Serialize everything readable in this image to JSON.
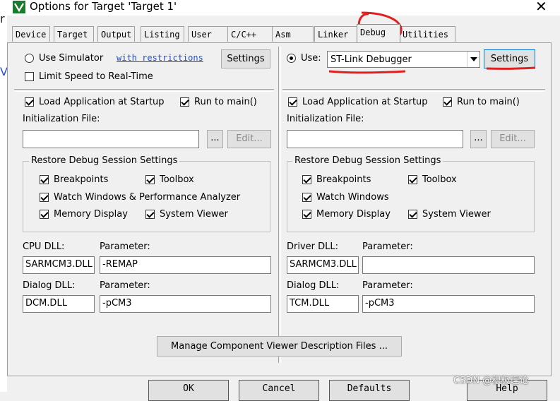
{
  "window": {
    "title": "Options for Target 'Target 1'",
    "close_glyph": "✕",
    "app_icon": "keil-uvision-icon",
    "edge_chars": [
      "r",
      "V"
    ]
  },
  "tabs": [
    {
      "label": "Device"
    },
    {
      "label": "Target"
    },
    {
      "label": "Output"
    },
    {
      "label": "Listing"
    },
    {
      "label": "User"
    },
    {
      "label": "C/C++"
    },
    {
      "label": "Asm"
    },
    {
      "label": "Linker"
    },
    {
      "label": "Debug",
      "active": true
    },
    {
      "label": "Utilities"
    }
  ],
  "left": {
    "use_simulator_label": "Use Simulator",
    "restrictions_link": "with restrictions",
    "settings_label": "Settings",
    "limit_speed_label": "Limit Speed to Real-Time",
    "load_app_label": "Load Application at Startup",
    "run_to_main_label": "Run to main()",
    "init_file_label": "Initialization File:",
    "init_file_value": "",
    "browse_label": "...",
    "edit_label": "Edit...",
    "restore_title": "Restore Debug Session Settings",
    "breakpoints_label": "Breakpoints",
    "toolbox_label": "Toolbox",
    "watch_label": "Watch Windows & Performance Analyzer",
    "memory_label": "Memory Display",
    "sysviewer_label": "System Viewer",
    "dll_label": "CPU DLL:",
    "dll_value": "SARMCM3.DLL",
    "param_label": "Parameter:",
    "param_value": "-REMAP",
    "dialog_dll_label": "Dialog DLL:",
    "dialog_dll_value": "DCM.DLL",
    "dialog_param_label": "Parameter:",
    "dialog_param_value": "-pCM3"
  },
  "right": {
    "use_label": "Use:",
    "debugger_value": "ST-Link Debugger",
    "settings_label": "Settings",
    "load_app_label": "Load Application at Startup",
    "run_to_main_label": "Run to main()",
    "init_file_label": "Initialization File:",
    "init_file_value": "",
    "browse_label": "...",
    "edit_label": "Edit...",
    "restore_title": "Restore Debug Session Settings",
    "breakpoints_label": "Breakpoints",
    "toolbox_label": "Toolbox",
    "watch_label": "Watch Windows",
    "memory_label": "Memory Display",
    "sysviewer_label": "System Viewer",
    "dll_label": "Driver DLL:",
    "dll_value": "SARMCM3.DLL",
    "param_label": "Parameter:",
    "param_value": "",
    "dialog_dll_label": "Dialog DLL:",
    "dialog_dll_value": "TCM.DLL",
    "dialog_param_label": "Parameter:",
    "dialog_param_value": "-pCM3"
  },
  "manage_button": "Manage Component Viewer Description Files ...",
  "footer": {
    "ok_label": "OK",
    "cancel_label": "Cancel",
    "defaults_label": "Defaults",
    "help_label": "Help"
  },
  "watermark": "CSDN @积极理论",
  "annotation_color": "#e02020"
}
